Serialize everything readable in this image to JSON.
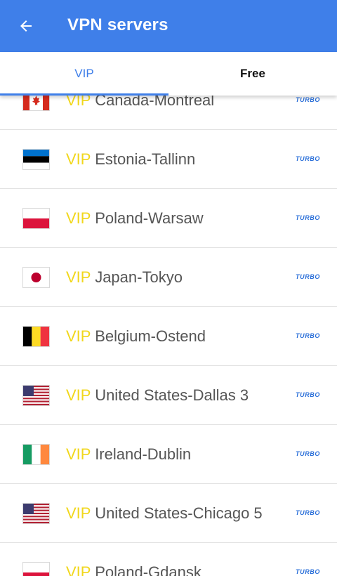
{
  "header": {
    "title": "VPN servers"
  },
  "tabs": [
    {
      "label": "VIP",
      "active": true
    },
    {
      "label": "Free",
      "active": false
    }
  ],
  "colors": {
    "appbar": "#3f7fe9",
    "vip": "#f1d71c",
    "turbo": "#2a6fd9"
  },
  "servers": [
    {
      "tier": "VIP",
      "name": "Canada-Montreal",
      "badge": "TURBO",
      "flag_icon": "flag-canada-icon"
    },
    {
      "tier": "VIP",
      "name": "Estonia-Tallinn",
      "badge": "TURBO",
      "flag_icon": "flag-estonia-icon"
    },
    {
      "tier": "VIP",
      "name": "Poland-Warsaw",
      "badge": "TURBO",
      "flag_icon": "flag-poland-icon"
    },
    {
      "tier": "VIP",
      "name": "Japan-Tokyo",
      "badge": "TURBO",
      "flag_icon": "flag-japan-icon"
    },
    {
      "tier": "VIP",
      "name": "Belgium-Ostend",
      "badge": "TURBO",
      "flag_icon": "flag-belgium-icon"
    },
    {
      "tier": "VIP",
      "name": "United States-Dallas 3",
      "badge": "TURBO",
      "flag_icon": "flag-usa-icon"
    },
    {
      "tier": "VIP",
      "name": "Ireland-Dublin",
      "badge": "TURBO",
      "flag_icon": "flag-ireland-icon"
    },
    {
      "tier": "VIP",
      "name": "United States-Chicago 5",
      "badge": "TURBO",
      "flag_icon": "flag-usa-icon"
    },
    {
      "tier": "VIP",
      "name": "Poland-Gdansk",
      "badge": "TURBO",
      "flag_icon": "flag-poland-icon"
    }
  ]
}
